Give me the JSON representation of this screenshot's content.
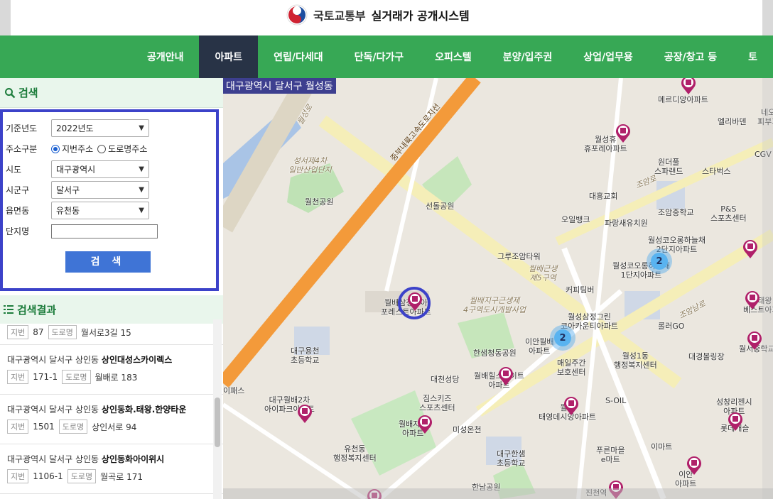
{
  "header": {
    "ministry": "국토교통부",
    "system": "실거래가 공개시스템"
  },
  "nav": {
    "items": [
      "공개안내",
      "아파트",
      "연립/다세대",
      "단독/다가구",
      "오피스텔",
      "분양/입주권",
      "상업/업무용",
      "공장/창고 등",
      "토"
    ],
    "active_index": 1
  },
  "search": {
    "title": "검색",
    "year_label": "기준년도",
    "year_value": "2022년도",
    "addr_type_label": "주소구분",
    "addr_opt1": "지번주소",
    "addr_opt2": "도로명주소",
    "sido_label": "시도",
    "sido_value": "대구광역시",
    "sigungu_label": "시군구",
    "sigungu_value": "달서구",
    "dong_label": "읍면동",
    "dong_value": "유천동",
    "complex_label": "단지명",
    "complex_value": "",
    "button": "검 색"
  },
  "results": {
    "title": "검색결과",
    "jibun_tag": "지번",
    "road_tag": "도로명",
    "items": [
      {
        "region": "",
        "name": "",
        "jibun": "87",
        "road": "월서로3길 15"
      },
      {
        "region": "대구광역시 달서구 상인동",
        "name": "상인대성스카이렉스",
        "jibun": "171-1",
        "road": "월배로 183"
      },
      {
        "region": "대구광역시 달서구 상인동",
        "name": "상인동화.태왕.한양타운",
        "jibun": "1501",
        "road": "상인서로 94"
      },
      {
        "region": "대구광역시 달서구 상인동",
        "name": "상인동화아이위시",
        "jibun": "1106-1",
        "road": "월곡로 171"
      }
    ]
  },
  "map": {
    "region_label": "대구광역시 달서구 월성동",
    "labels": {
      "l1": "성서제4차\n일반산업단지",
      "l2": "월천공원",
      "l3": "선돌공원",
      "l4": "대흥교회",
      "l5": "오일뱅크",
      "l6": "파랑새유치원",
      "l7": "그루조암타워",
      "l8": "월배근생\n제5구역",
      "l9": "커피팀버",
      "l10": "월배지구근생제\n4구역도시개발사업",
      "l11": "월성삼정그린\n코아카운티아파트",
      "l12": "롤러GO",
      "l13": "대경볼링장",
      "l14": "월성1동\n행정복지센터",
      "l15": "매일주간\n보호센터",
      "l16": "S-OIL",
      "l17": "한샘청동공원",
      "l18": "대천성당",
      "l19": "짐스키즈\n스포츠센터",
      "l20": "미성온천",
      "l21": "대구용천\n초등학교",
      "l22": "대구월배2차\n아이파크아파트",
      "l23": "유천동\n행정복지센터",
      "l24": "대구한샘\n초등학교",
      "l25": "한남공원",
      "l26": "푸른마을\ne마트",
      "l27": "이마트",
      "l28": "성창리젠시\n아파트",
      "l29": "월성휴\n휴포레아파트",
      "l30": "원더풀\n스파랜드",
      "l31": "스타벅스",
      "l32": "엘리바덴",
      "l33": "조암중학교",
      "l34": "P&S\n스포츠센터",
      "l35": "월성코오롱하늘채\n2단지아파트",
      "l36": "월성코오롱하늘채\n1단지아파트",
      "l37": "월배삼정코아\n포레스트아파트",
      "l38": "이안월배\n아파트",
      "l39": "월배힐스테이트\n아파트",
      "l40": "월배자이\n아파트",
      "l41": "월배\n태영데시앙아파트",
      "l42": "월서중학교",
      "l43": "태왕\n베스트아파트",
      "l44": "롯데캐슬",
      "l45": "진천역",
      "l46": "이안\n아파트",
      "l47": "메르디앙아파트",
      "l48": "네오\n피부과",
      "l49": "CGV",
      "l50": "이패스",
      "road1": "중부내륙고속도로지선",
      "road2": "조암로",
      "road3": "월성로",
      "road4": "조암남로",
      "road5": "월곡로"
    },
    "clusters": [
      "2",
      "2"
    ]
  },
  "colors": {
    "nav_bg": "#37a855",
    "nav_active": "#283346",
    "accent": "#3c42c9",
    "button": "#3f74d6",
    "pin": "#b0206a",
    "highway": "#f39a3a"
  }
}
